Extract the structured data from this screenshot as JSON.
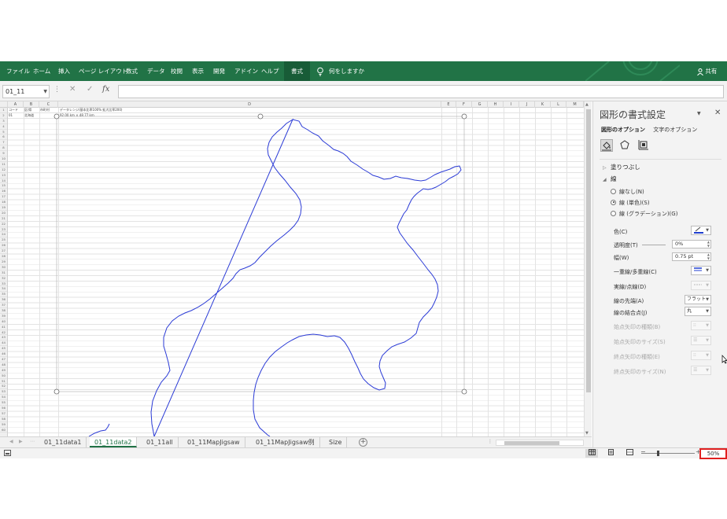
{
  "ribbon": {
    "tabs": [
      "ファイル",
      "ホーム",
      "挿入",
      "ページ レイアウト",
      "数式",
      "データ",
      "校閲",
      "表示",
      "開発",
      "アドイン",
      "ヘルプ",
      "書式"
    ],
    "active_tab": "書式",
    "tell_me": "何をしますか",
    "share": "共有",
    "colors": {
      "ribbon_bg": "#217346",
      "active_tab_bg": "#185c37"
    }
  },
  "formula_bar": {
    "name_box": "01_11",
    "fx": "fx",
    "formula": ""
  },
  "grid": {
    "columns": [
      "A",
      "B",
      "C",
      "D",
      "E",
      "F",
      "G",
      "H",
      "I",
      "J",
      "K",
      "L",
      "M"
    ],
    "rows": [
      "1",
      "2",
      "3",
      "4",
      "5",
      "6",
      "7",
      "8",
      "9",
      "10",
      "11",
      "12",
      "13",
      "14",
      "15",
      "16",
      "17",
      "18",
      "19",
      "20",
      "21",
      "22",
      "23",
      "24",
      "25",
      "26",
      "27",
      "28",
      "29",
      "30",
      "31",
      "32",
      "33",
      "34",
      "35",
      "36",
      "37",
      "38",
      "39",
      "40",
      "41",
      "42",
      "43",
      "44",
      "45",
      "46",
      "47",
      "48",
      "49",
      "50",
      "51",
      "52",
      "53",
      "54",
      "55",
      "56",
      "57",
      "58",
      "59",
      "60"
    ],
    "cells": {
      "a1": "コード",
      "b1": "区/県",
      "c1": "市町村",
      "d1": "データレンジ(基本比率100%  拡大比率200)",
      "a2": "01",
      "b2": "北海道",
      "d2": "92.00 km × 48.77 km"
    },
    "shape_outline_color": "#2b3bd6"
  },
  "sheet_tabs": {
    "sheets": [
      "01_11data1",
      "01_11data2",
      "01_11all",
      "01_11MapJigsaw",
      "01_11MapJigsaw例",
      "Size"
    ],
    "active": "01_11data2",
    "add_label": "+"
  },
  "status_bar": {
    "zoom": "50%"
  },
  "format_pane": {
    "title": "図形の書式設定",
    "tabs": [
      "図形のオプション",
      "文字のオプション"
    ],
    "active_tab": "図形のオプション",
    "sections": {
      "fill": "塗りつぶし",
      "line": "線"
    },
    "line_options": [
      "線なし(N)",
      "線 (単色)(S)",
      "線 (グラデーション)(G)"
    ],
    "selected_line_option": "線 (単色)(S)",
    "properties": {
      "color_label": "色(C)",
      "transparency_label": "透明度(T)",
      "transparency_value": "0%",
      "width_label": "幅(W)",
      "width_value": "0.75 pt",
      "compound_label": "一重線/多重線(C)",
      "dash_label": "実線/点線(D)",
      "cap_label": "線の先端(A)",
      "cap_value": "フラット",
      "join_label": "線の結合点(J)",
      "join_value": "丸",
      "begin_arrow_type_label": "始点矢印の種類(B)",
      "begin_arrow_size_label": "始点矢印のサイズ(S)",
      "end_arrow_type_label": "終点矢印の種類(E)",
      "end_arrow_size_label": "終点矢印のサイズ(N)"
    },
    "line_color": "#1f3fd0"
  }
}
